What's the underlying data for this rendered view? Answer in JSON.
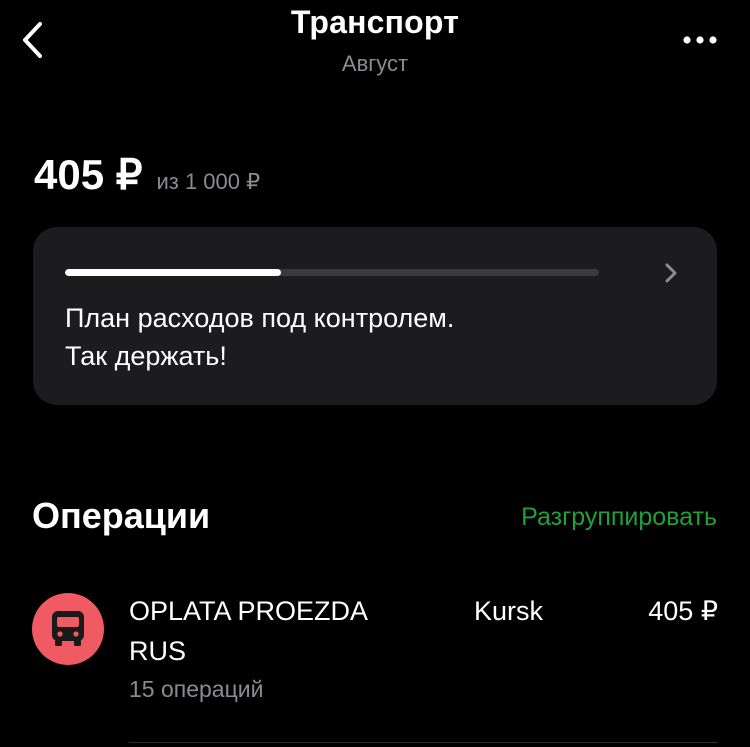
{
  "header": {
    "title": "Транспорт",
    "subtitle": "Август",
    "back_icon": "chevron-left-icon",
    "more_icon": "more-horizontal-icon"
  },
  "budget": {
    "spent": "405 ₽",
    "limit": "из 1 000 ₽",
    "progress": 0.405,
    "message_line1": "План расходов под контролем.",
    "message_line2": "Так держать!",
    "chevron_icon": "chevron-right-icon"
  },
  "operations": {
    "title": "Операции",
    "ungroup_label": "Разгруппировать",
    "items": [
      {
        "name": "OPLATA PROEZDA RUS",
        "city": "Kursk",
        "amount": "405 ₽",
        "count": "15 операций",
        "icon": "bus-icon"
      }
    ]
  },
  "colors": {
    "background": "#000000",
    "card": "#1c1c1e",
    "accent_green": "#21a038",
    "avatar_red": "#f05a63",
    "secondary_text": "#8b8b90"
  }
}
